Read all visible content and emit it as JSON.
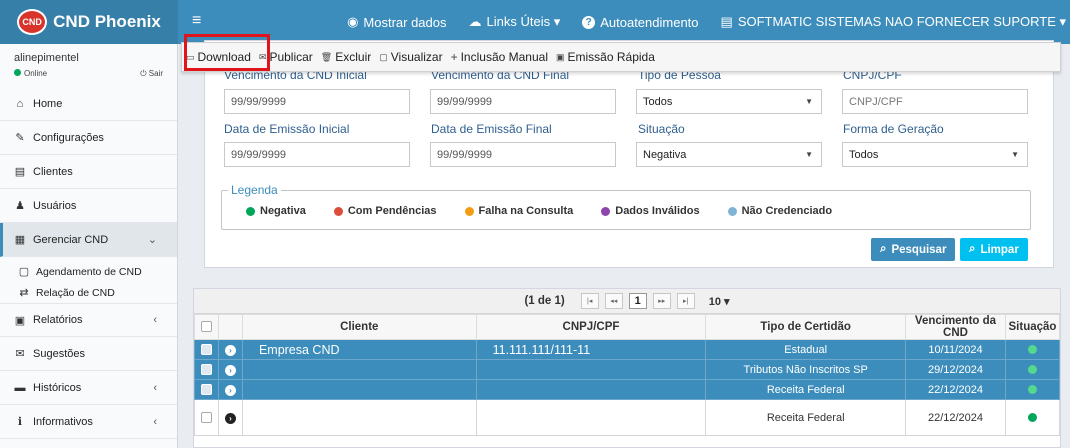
{
  "app": {
    "logo_badge": "CND",
    "title": "CND Phoenix"
  },
  "topnav": [
    {
      "icon": "eye-icon",
      "label": "Mostrar dados"
    },
    {
      "icon": "cloud-icon",
      "label": "Links Úteis ▾"
    },
    {
      "icon": "question-icon",
      "label": "Autoatendimento"
    },
    {
      "icon": "building-icon",
      "label": "SOFTMATIC SISTEMAS NAO FORNECER SUPORTE ▾"
    }
  ],
  "user": {
    "name": "alinepimentel",
    "status": "Online",
    "logout": "Sair"
  },
  "sidebar": {
    "items": [
      {
        "label": "Home",
        "icon": "home-icon"
      },
      {
        "label": "Configurações",
        "icon": "wrench-icon"
      },
      {
        "label": "Clientes",
        "icon": "list-icon"
      },
      {
        "label": "Usuários",
        "icon": "user-icon"
      },
      {
        "label": "Gerenciar CND",
        "icon": "calendar-icon"
      },
      {
        "label": "Relatórios",
        "icon": "report-icon"
      },
      {
        "label": "Sugestões",
        "icon": "chat-icon"
      },
      {
        "label": "Históricos",
        "icon": "history-icon"
      },
      {
        "label": "Informativos",
        "icon": "info-icon"
      }
    ],
    "subitems": [
      {
        "label": "Agendamento de CND",
        "icon": "calendar-icon"
      },
      {
        "label": "Relação de CND",
        "icon": "retweet-icon"
      }
    ]
  },
  "toolbar": [
    "Download",
    "Publicar",
    "Excluir",
    "Visualizar",
    "Inclusão Manual",
    "Emissão Rápida"
  ],
  "filters": {
    "row1": [
      {
        "label": "Vencimento da CND Inicial",
        "value": "99/99/9999"
      },
      {
        "label": "Vencimento da CND Final",
        "value": "99/99/9999"
      },
      {
        "label": "Tipo de Pessoa",
        "value": "Todos"
      },
      {
        "label": "CNPJ/CPF",
        "value": "CNPJ/CPF"
      }
    ],
    "row2": [
      {
        "label": "Data de Emissão Inicial",
        "value": "99/99/9999"
      },
      {
        "label": "Data de Emissão Final",
        "value": "99/99/9999"
      },
      {
        "label": "Situação",
        "value": "Negativa"
      },
      {
        "label": "Forma de Geração",
        "value": "Todos"
      }
    ]
  },
  "legend": {
    "title": "Legenda",
    "items": [
      {
        "label": "Negativa",
        "color": "#00a65a"
      },
      {
        "label": "Com Pendências",
        "color": "#dd4b39"
      },
      {
        "label": "Falha na Consulta",
        "color": "#f39c12"
      },
      {
        "label": "Dados Inválidos",
        "color": "#8e44ad"
      },
      {
        "label": "Não Credenciado",
        "color": "#7fb3d5"
      }
    ]
  },
  "buttons": {
    "search": "Pesquisar",
    "clear": "Limpar"
  },
  "pager": {
    "info": "(1 de 1)",
    "current": "1",
    "page_size": "10 ▾"
  },
  "table": {
    "headers": [
      "Cliente",
      "CNPJ/CPF",
      "Tipo de Certidão",
      "Vencimento da CND",
      "Situação"
    ],
    "rows": [
      {
        "cliente": "Empresa CND",
        "cnpj": "11.111.111/111-11",
        "tipo": "Estadual",
        "venc": "10/11/2024",
        "selected": true
      },
      {
        "cliente": "",
        "cnpj": "",
        "tipo": "Tributos Não Inscritos SP",
        "venc": "29/12/2024",
        "selected": true
      },
      {
        "cliente": "",
        "cnpj": "",
        "tipo": "Receita Federal",
        "venc": "22/12/2024",
        "selected": true
      },
      {
        "cliente": "",
        "cnpj": "",
        "tipo": "Receita Federal",
        "venc": "22/12/2024",
        "selected": false
      }
    ]
  }
}
